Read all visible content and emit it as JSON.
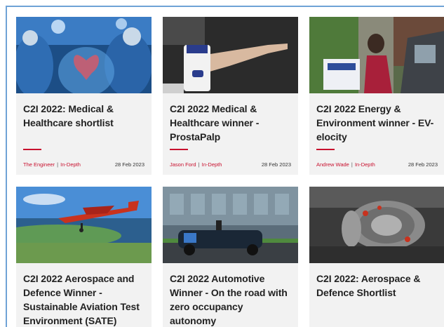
{
  "cards": [
    {
      "title": "C2I 2022: Medical & Healthcare shortlist",
      "author": "The Engineer",
      "category": "In-Depth",
      "date": "28 Feb 2023",
      "image": "surgeons-heart-hologram-image"
    },
    {
      "title": "C2I 2022 Medical & Healthcare winner - ProstaPalp",
      "author": "Jason Ford",
      "category": "In-Depth",
      "date": "28 Feb 2023",
      "image": "finger-device-image"
    },
    {
      "title": "C2I 2022 Energy & Environment winner - EV-elocity",
      "author": "Andrew Wade",
      "category": "In-Depth",
      "date": "28 Feb 2023",
      "image": "ev-charging-woman-image"
    },
    {
      "title": "C2I 2022 Aerospace and Defence Winner - Sustainable Aviation Test Environment (SATE)",
      "image": "red-plane-coast-image"
    },
    {
      "title": "C2I 2022 Automotive Winner - On the road with zero occupancy autonomy",
      "image": "autonomous-pod-image"
    },
    {
      "title": "C2I 2022: Aerospace & Defence Shortlist",
      "image": "jet-engine-image"
    }
  ],
  "meta_separator": "|",
  "colors": {
    "accent": "#c8102e",
    "card_bg": "#f2f2f2",
    "frame": "#6fa3d6"
  }
}
